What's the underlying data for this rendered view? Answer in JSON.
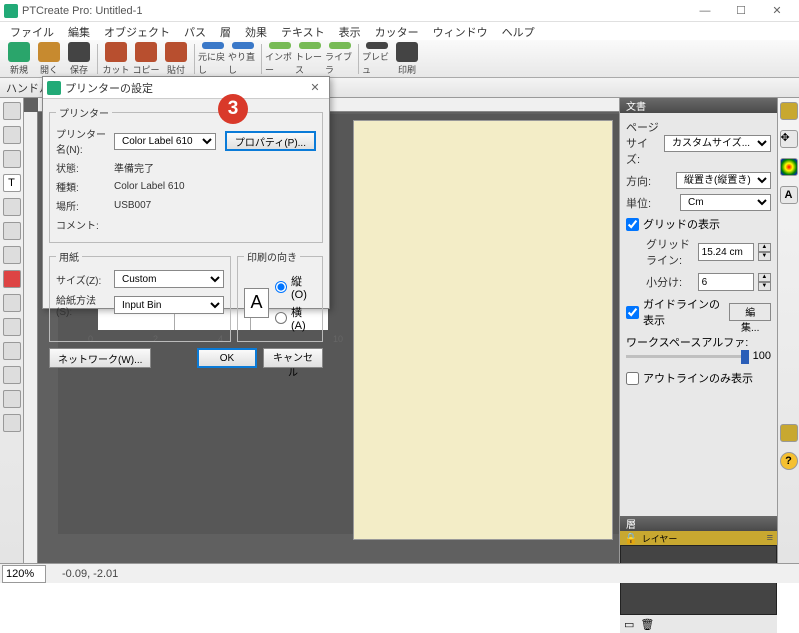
{
  "app": {
    "title": "PTCreate Pro: Untitled-1"
  },
  "menu": [
    "ファイル",
    "編集",
    "オブジェクト",
    "パス",
    "層",
    "効果",
    "テキスト",
    "表示",
    "カッター",
    "ウィンドウ",
    "ヘルプ"
  ],
  "toolbar": [
    {
      "label": "新規",
      "icon": "#2aa56b"
    },
    {
      "label": "開く",
      "icon": "#c78a2f"
    },
    {
      "label": "保存",
      "icon": "#444"
    },
    {
      "label": "sep"
    },
    {
      "label": "カット",
      "icon": "#b84f2f"
    },
    {
      "label": "コピー",
      "icon": "#b84f2f"
    },
    {
      "label": "貼付",
      "icon": "#b84f2f"
    },
    {
      "label": "sep"
    },
    {
      "label": "元に戻し",
      "icon": "#3a78c8"
    },
    {
      "label": "やり直し",
      "icon": "#3a78c8"
    },
    {
      "label": "sep"
    },
    {
      "label": "インポー",
      "icon": "#7b5"
    },
    {
      "label": "トレース",
      "icon": "#7b5"
    },
    {
      "label": "ライブラ",
      "icon": "#7b5"
    },
    {
      "label": "sep"
    },
    {
      "label": "プレビュ",
      "icon": "#444"
    },
    {
      "label": "印刷",
      "icon": "#444"
    }
  ],
  "handleLabel": "ハンドル:",
  "dialog": {
    "title": "プリンターの設定",
    "group_printer": "プリンター",
    "name_lbl": "プリンター名(N):",
    "name_val": "Color Label 610",
    "prop_btn": "プロパティ(P)...",
    "status_lbl": "状態:",
    "status_val": "準備完了",
    "type_lbl": "種類:",
    "type_val": "Color Label 610",
    "where_lbl": "場所:",
    "where_val": "USB007",
    "comment_lbl": "コメント:",
    "group_paper": "用紙",
    "size_lbl": "サイズ(Z):",
    "size_val": "Custom",
    "source_lbl": "給紙方法(S):",
    "source_val": "Input Bin",
    "group_orient": "印刷の向き",
    "orient_portrait": "縦(O)",
    "orient_landscape": "横(A)",
    "network_btn": "ネットワーク(W)...",
    "ok_btn": "OK",
    "cancel_btn": "キャンセル"
  },
  "callout": "3",
  "rightpanel": {
    "doc_head": "文書",
    "pagesize_lbl": "ページサイズ:",
    "pagesize_val": "カスタムサイズ...",
    "orient_lbl": "方向:",
    "orient_val": "縦置き(縦置き)",
    "units_lbl": "単位:",
    "units_val": "Cm",
    "showgrid": "グリッドの表示",
    "gridline_lbl": "グリッドライン:",
    "gridline_val": "15.24 cm",
    "subdiv_lbl": "小分け:",
    "subdiv_val": "6",
    "showguides": "ガイドラインの表示",
    "edit_btn": "編集...",
    "ws_alpha_lbl": "ワークスペースアルファ:",
    "ws_alpha_val": "100",
    "outline_only": "アウトラインのみ表示",
    "layers_head": "層",
    "layer_name": "レイヤー"
  },
  "status": {
    "zoom": "120%",
    "coords": "-0.09, -2.01"
  }
}
